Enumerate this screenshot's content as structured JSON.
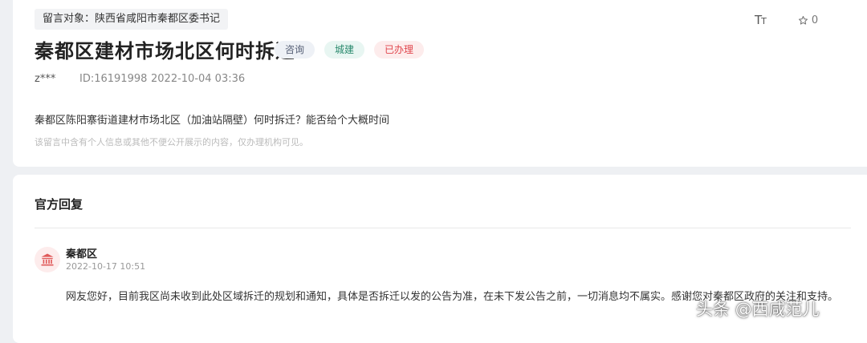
{
  "message": {
    "target": "留言对象：陕西省咸阳市秦都区委书记",
    "title": "秦都区建材市场北区何时拆迁",
    "tags": {
      "consult": "咨询",
      "city": "城建",
      "status": "已办理"
    },
    "user": "z***",
    "id_text": "ID:16191998",
    "datetime": "2022-10-04 03:36",
    "body": "秦都区陈阳寨街道建材市场北区（加油站隔壁）何时拆迁？能否给个大概时间",
    "privacy_note": "该留言中含有个人信息或其他不便公开展示的内容，仅办理机构可见。",
    "font_label": "T",
    "font_label_small": "T",
    "favorites": "0"
  },
  "reply": {
    "heading": "官方回复",
    "org": "秦都区",
    "time": "2022-10-17 10:51",
    "text": "网友您好，目前我区尚未收到此处区域拆迁的规划和通知，具体是否拆迁以发的公告为准，在未下发公告之前，一切消息均不属实。感谢您对秦都区政府的关注和支持。"
  },
  "watermark": "头条 @西咸范儿",
  "colors": {
    "tag_done_text": "#e0464d",
    "tag_city_text": "#2b8a6e",
    "avatar_bg": "#fdecec",
    "avatar_icon": "#e05a5a"
  },
  "icons": {
    "font_size": "font-size-icon",
    "favorite": "star-icon",
    "org_avatar": "government-building-icon"
  }
}
